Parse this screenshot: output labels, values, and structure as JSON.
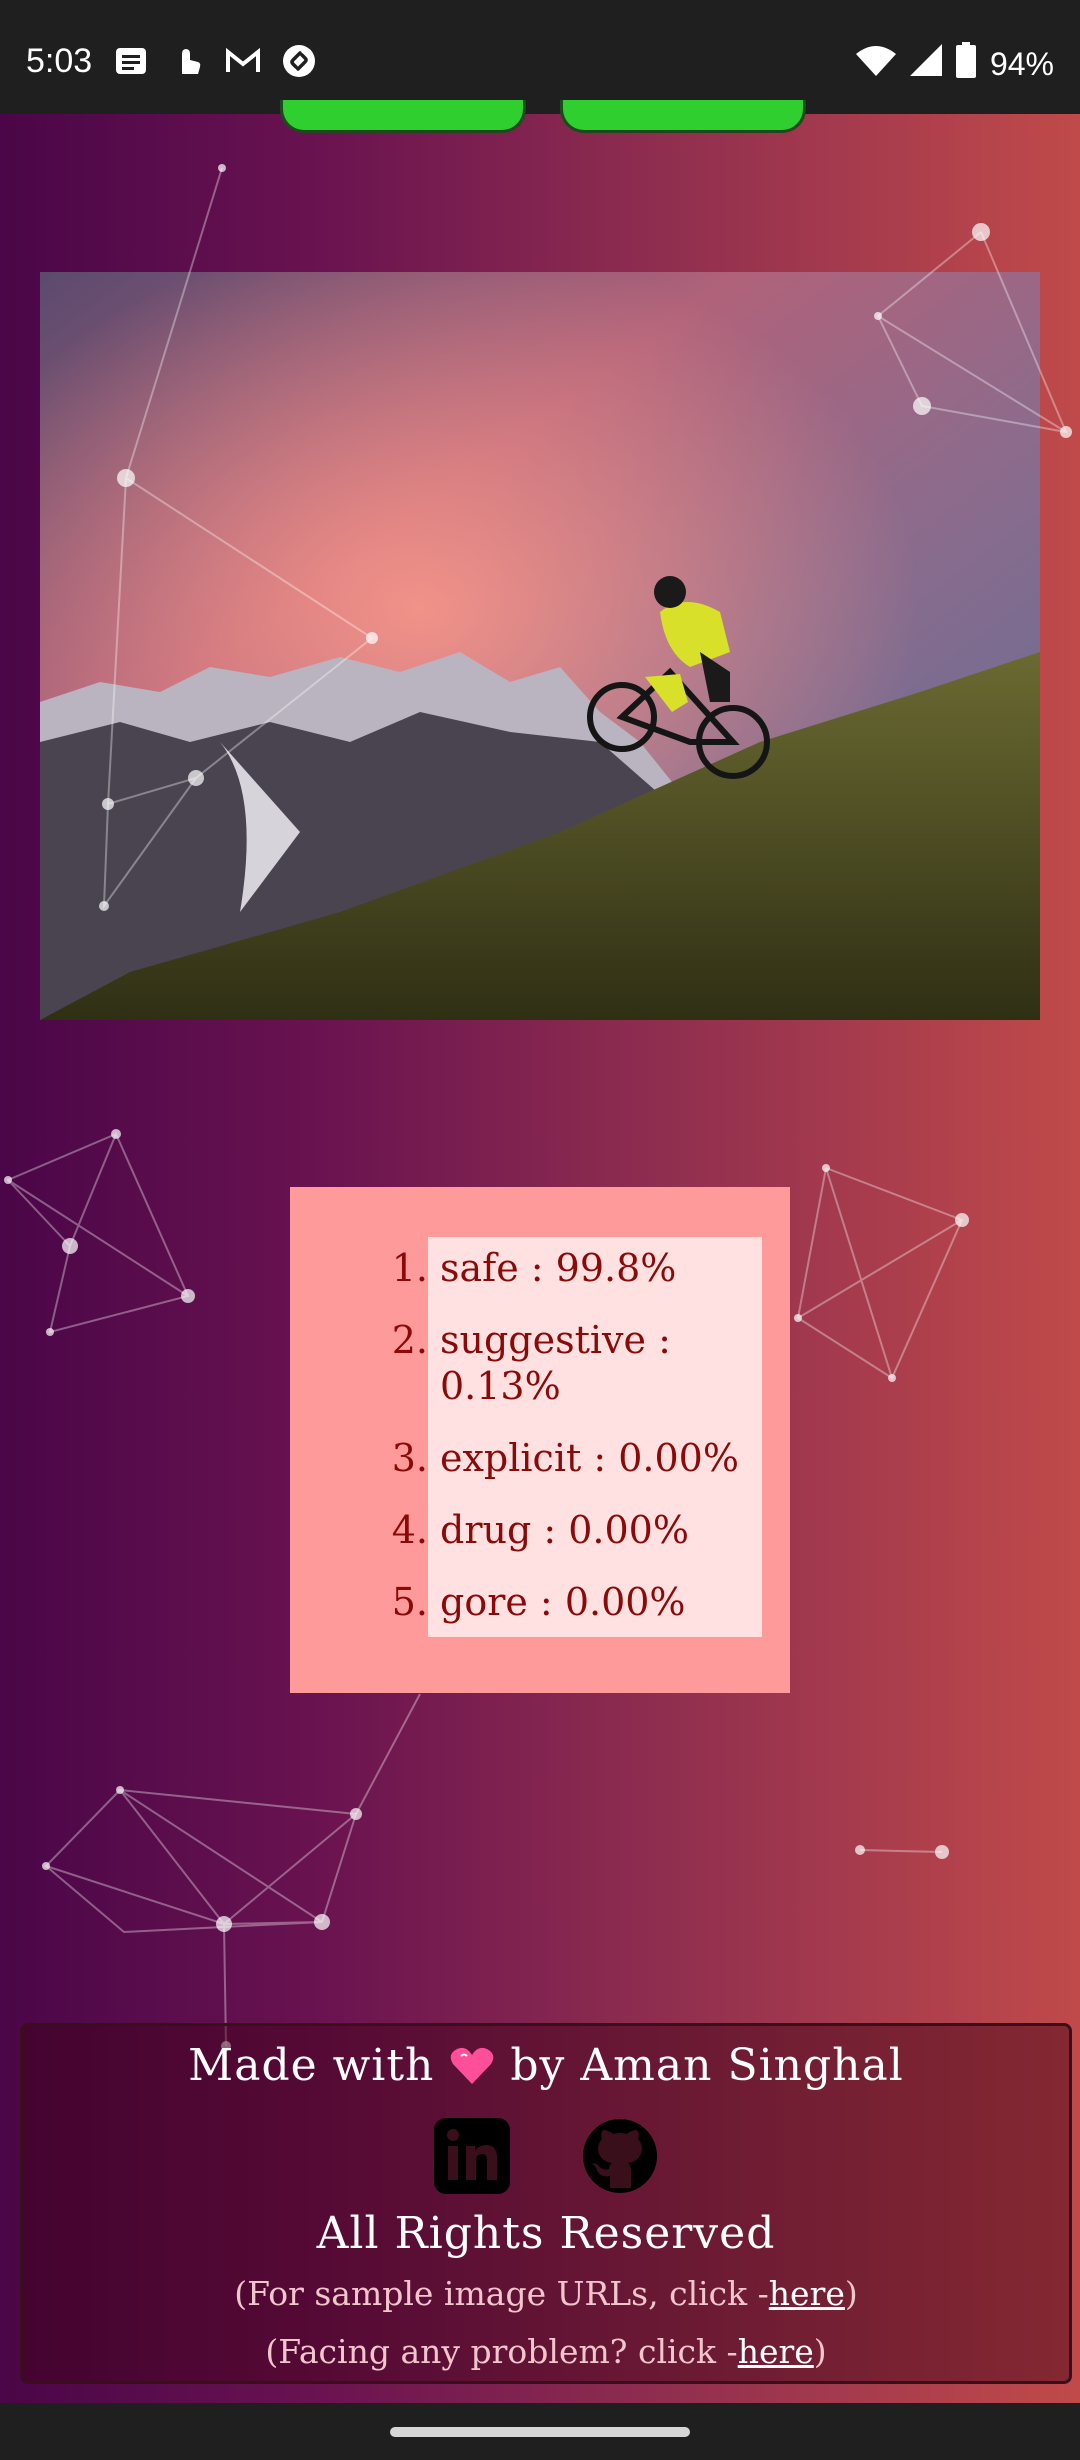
{
  "status_bar": {
    "time": "5:03",
    "left_icons": [
      "news-icon",
      "touch-icon",
      "gmail-icon",
      "shazam-icon"
    ],
    "right_icons": [
      "wifi-icon",
      "signal-icon",
      "battery-icon"
    ],
    "battery": "94%"
  },
  "results": {
    "items": [
      {
        "num": "1.",
        "text": "safe : 99.8%"
      },
      {
        "num": "2.",
        "text": "suggestive : 0.13%"
      },
      {
        "num": "3.",
        "text": "explicit : 0.00%"
      },
      {
        "num": "4.",
        "text": "drug : 0.00%"
      },
      {
        "num": "5.",
        "text": "gore : 0.00%"
      }
    ]
  },
  "footer": {
    "made_with_prefix": "Made with",
    "made_with_suffix": "by Aman Singhal",
    "heart_icon": "heart-icon",
    "social": [
      "linkedin-icon",
      "github-icon"
    ],
    "rights": "All Rights Reserved",
    "sample_note_prefix": "(For sample image URLs, click -",
    "sample_note_link": "here",
    "sample_note_suffix": ")",
    "problem_note_prefix": "(Facing any problem? click -",
    "problem_note_link": "here",
    "problem_note_suffix": ")"
  },
  "colors": {
    "card_background": "#ff9a9a",
    "list_background": "#ffe1e1",
    "result_text": "#8a0a0a",
    "top_button": "#2ecf2e"
  }
}
